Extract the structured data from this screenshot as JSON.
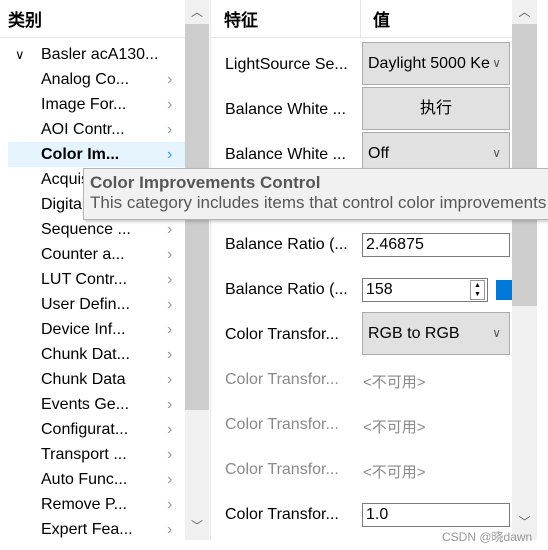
{
  "left_panel": {
    "header": "类别",
    "root": "Basler acA130...",
    "items": [
      {
        "label": "Analog Co..."
      },
      {
        "label": "Image For..."
      },
      {
        "label": "AOI Contr..."
      },
      {
        "label": "Color Im...",
        "selected": true
      },
      {
        "label": "Acquisition..."
      },
      {
        "label": "Digital..."
      },
      {
        "label": "Sequence ..."
      },
      {
        "label": "Counter a..."
      },
      {
        "label": "LUT Contr..."
      },
      {
        "label": "User Defin..."
      },
      {
        "label": "Device Inf..."
      },
      {
        "label": "Chunk Dat..."
      },
      {
        "label": "Chunk Data"
      },
      {
        "label": "Events Ge..."
      },
      {
        "label": "Configurat..."
      },
      {
        "label": "Transport ..."
      },
      {
        "label": "Auto Func..."
      },
      {
        "label": "Remove P..."
      },
      {
        "label": "Expert Fea..."
      }
    ]
  },
  "right_panel": {
    "header_feature": "特征",
    "header_value": "值",
    "rows": [
      {
        "name": "LightSource Se...",
        "type": "combo",
        "value": "Daylight 5000 Ke"
      },
      {
        "name": "Balance White ...",
        "type": "button",
        "value": "执行"
      },
      {
        "name": "Balance White ...",
        "type": "combo",
        "value": "Off"
      },
      {
        "name": "",
        "type": "hidden",
        "value": ""
      },
      {
        "name": "Balance Ratio (...",
        "type": "text",
        "value": "2.46875"
      },
      {
        "name": "Balance Ratio (...",
        "type": "spin",
        "value": "158"
      },
      {
        "name": "Color Transfor...",
        "type": "combo",
        "value": "RGB to RGB"
      },
      {
        "name": "Color Transfor...",
        "type": "disabled",
        "value": "<不可用>"
      },
      {
        "name": "Color Transfor...",
        "type": "disabled",
        "value": "<不可用>"
      },
      {
        "name": "Color Transfor...",
        "type": "disabled",
        "value": "<不可用>"
      },
      {
        "name": "Color Transfor...",
        "type": "text",
        "value": "1.0"
      }
    ]
  },
  "tooltip": {
    "title": "Color Improvements Control",
    "description": "This category includes items that control color improvements"
  },
  "watermark": "CSDN @晓dawn",
  "colors": {
    "selection": "#e5f3fd",
    "accent": "#0078d7",
    "slider": "#0078d7"
  }
}
